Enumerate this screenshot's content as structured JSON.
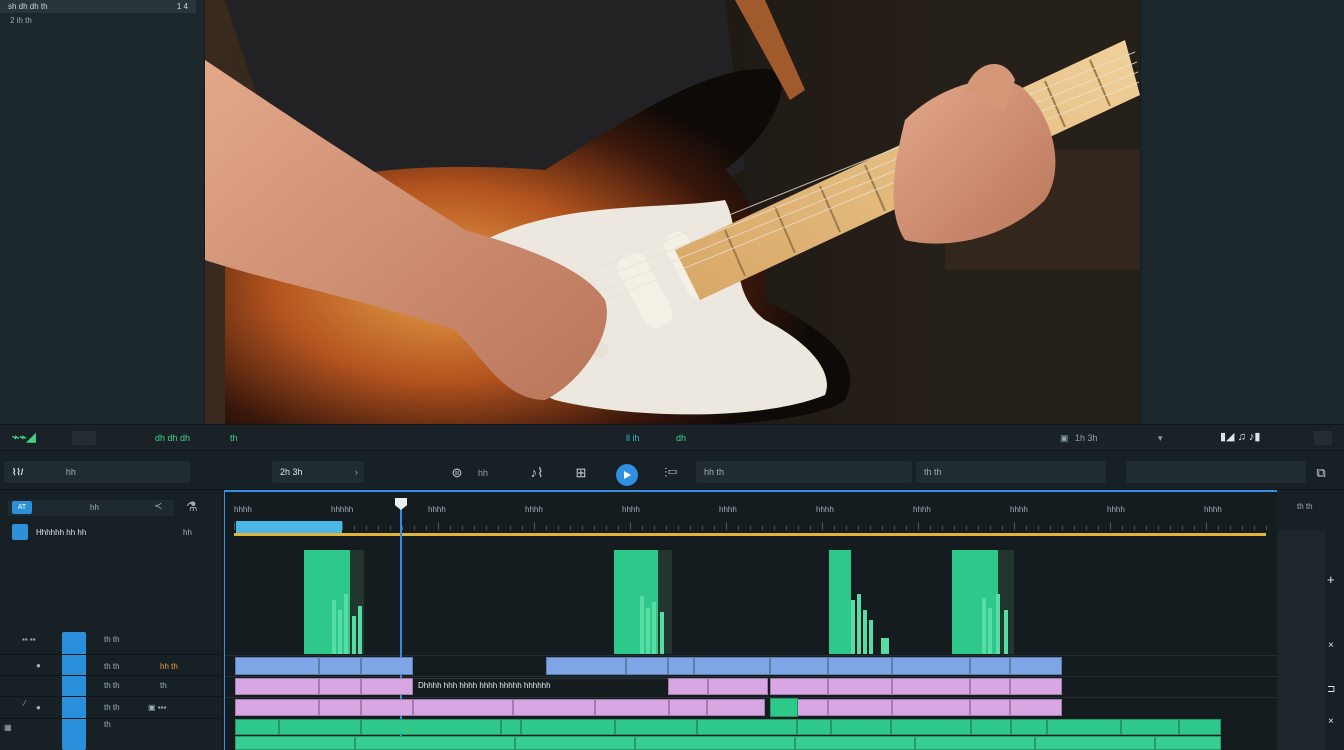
{
  "left_panel": {
    "title": "sh dh dh th",
    "title_right": "1  4",
    "subtitle": "2 ih th"
  },
  "toolbar1": {
    "left_label": "dh dh dh",
    "right_label": "th",
    "center_label_1": "ll ih",
    "center_label_2": "dh",
    "right_group_label": "1h 3h"
  },
  "toolbar2": {
    "audio_label": "hh",
    "field1_label": "2h 3h",
    "field2_label": "hh",
    "field3_label": "hh th",
    "field4_label": "th th",
    "field5_label": "th th"
  },
  "track_panel": {
    "chip_label": "AT",
    "header_label": "hh",
    "item_label": "Hhhhhh hh hh",
    "item_right": "hh",
    "row1_label": "th th",
    "row1_right": "hh th",
    "row2_label": "th th",
    "row2_right": "th",
    "row3_label": "th th",
    "row3_right": "th th",
    "row4_label": "th"
  },
  "ruler": {
    "labels": [
      "hhhh",
      "hhhhh",
      "hhhh",
      "hhhh",
      "hhhh",
      "hhhh",
      "hhhh",
      "hhhh",
      "hhhh",
      "hhhh",
      "hhhh"
    ]
  },
  "clip_caption": "Dhhhh hhh hhhh hhhh hhhhh hhhhhh",
  "colors": {
    "accent": "#2f8fe0",
    "green": "#2ec98a",
    "blue_clip": "#7ea6e6",
    "pink_clip": "#d9a6e4",
    "playhead": "#2f8fe0",
    "range": "#e0b53a"
  }
}
